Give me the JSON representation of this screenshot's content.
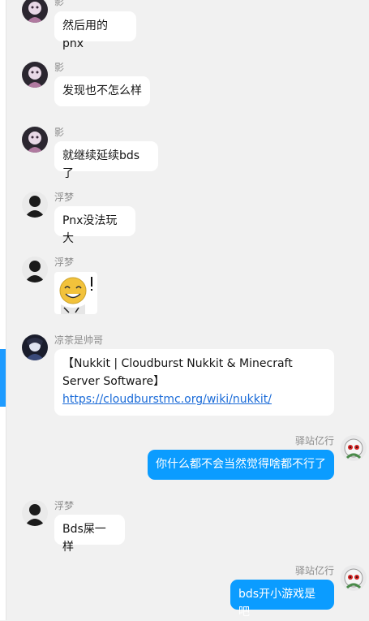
{
  "messages": [
    {
      "sender": "影",
      "text": "然后用的pnx"
    },
    {
      "sender": "影",
      "text": "发现也不怎么样"
    },
    {
      "sender": "影",
      "text": "就继续延续bds了"
    },
    {
      "sender": "浮梦",
      "text": "Pnx没法玩大"
    },
    {
      "sender": "浮梦",
      "sticker": "smiley-sticker"
    },
    {
      "sender": "凉茶是帅哥",
      "text_prefix": "【Nukkit | Cloudburst Nukkit & Minecraft Server Software】",
      "link": "https://cloudburstmc.org/wiki/nukkit/"
    },
    {
      "sender": "驿站亿行",
      "text": "你什么都不会当然觉得啥都不行了",
      "self": true
    },
    {
      "sender": "浮梦",
      "text": "Bds屎一样"
    },
    {
      "sender": "驿站亿行",
      "text": "bds开小游戏是吧",
      "self": true
    }
  ],
  "colors": {
    "self_bubble": "#0b9cff",
    "link": "#1a6bd8",
    "accent": "#1e9bff"
  }
}
